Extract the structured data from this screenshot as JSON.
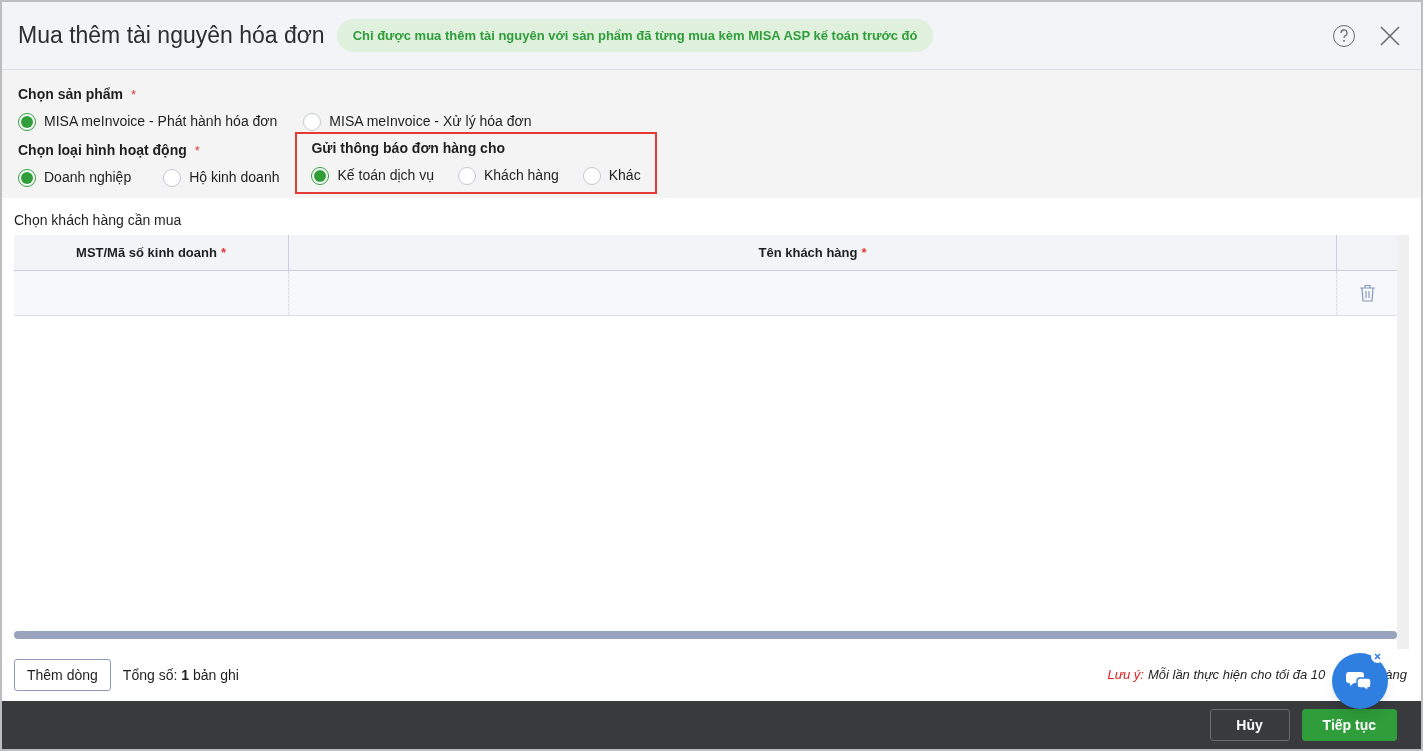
{
  "dialog": {
    "title": "Mua thêm tài nguyên hóa đơn",
    "notice": "Chỉ được mua thêm tài nguyên với sản phẩm đã từng mua kèm MISA ASP kế toán trước đó"
  },
  "product": {
    "label": "Chọn sản phẩm",
    "required_mark": "*",
    "options": [
      {
        "label": "MISA meInvoice - Phát hành hóa đơn",
        "selected": true
      },
      {
        "label": "MISA meInvoice - Xử lý hóa đơn",
        "selected": false
      }
    ]
  },
  "business_type": {
    "label": "Chọn loại hình hoạt động",
    "required_mark": "*",
    "options": [
      {
        "label": "Doanh nghiệp",
        "selected": true
      },
      {
        "label": "Hộ kinh doanh",
        "selected": false
      }
    ]
  },
  "notify": {
    "label": "Gửi thông báo đơn hàng cho",
    "highlighted": true,
    "options": [
      {
        "label": "Kế toán dịch vụ",
        "selected": true
      },
      {
        "label": "Khách hàng",
        "selected": false
      },
      {
        "label": "Khác",
        "selected": false
      }
    ]
  },
  "table": {
    "title": "Chọn khách hàng cần mua",
    "columns": [
      {
        "label": "MST/Mã số kinh doanh",
        "required_mark": "*"
      },
      {
        "label": "Tên khách hàng",
        "required_mark": "*"
      }
    ],
    "rows": [
      {
        "tax_code": "",
        "name": ""
      }
    ]
  },
  "add_row_button": "Thêm dòng",
  "total": {
    "label": "Tổng số:",
    "count": "1",
    "unit": "bản ghi"
  },
  "note": {
    "label": "Lưu ý:",
    "text_before": "Mỗi lần thực hiện cho tối đa 10",
    "text_after": "àng"
  },
  "buttons": [
    {
      "label": "Hủy",
      "kind": "secondary"
    },
    {
      "label": "Tiếp tục",
      "kind": "primary"
    }
  ]
}
